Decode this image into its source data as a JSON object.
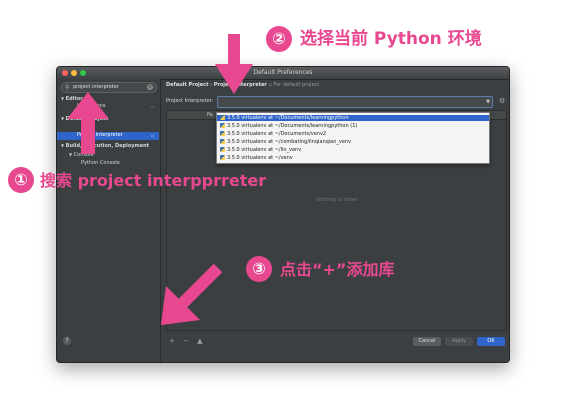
{
  "annotations": {
    "step1": {
      "number": "①",
      "text": "搜索 project interpprreter"
    },
    "step2": {
      "number": "②",
      "text": "选择当前 Python 环境"
    },
    "step3": {
      "number": "③",
      "text": "点击“+”添加库"
    },
    "accent_color": "#e8488f"
  },
  "window": {
    "title": "Default Preferences",
    "traffic_lights": [
      "#fc605b",
      "#fdbc40",
      "#34c84a"
    ]
  },
  "sidebar": {
    "search_value": "project interpreter",
    "items": [
      {
        "label": "Editor",
        "expanded": true
      },
      {
        "label": "Inspections"
      },
      {
        "label": "Default Project",
        "expanded": true
      },
      {
        "label": "Project Interpreter",
        "selected": true
      },
      {
        "label": "Build, Execution, Deployment",
        "expanded": true
      },
      {
        "label": "Console",
        "expanded": true
      },
      {
        "label": "Python Console"
      }
    ]
  },
  "main": {
    "breadcrumb_parent": "Default Project",
    "breadcrumb_sep": "›",
    "breadcrumb_current": "Project Interpreter",
    "breadcrumb_sub": "For default project",
    "interpreter_label": "Project Interpreter:",
    "column_label": "Pa",
    "empty_text": "Nothing to show",
    "table_tools": "+ − ▲"
  },
  "dropdown": {
    "items": [
      {
        "label": "3.5.0 virtualenv at ~/Documents/learningpython",
        "selected": true
      },
      {
        "label": "3.5.0 virtualenv at ~/Documents/learningpython (1)"
      },
      {
        "label": "3.5.0 virtualenv at ~/Documents/venv2"
      },
      {
        "label": "3.5.0 virtualenv at ~/combating/linqianqian_venv"
      },
      {
        "label": "3.5.0 virtualenv at ~/lin_venv"
      },
      {
        "label": "3.5.0 virtualenv at ~/venv"
      }
    ]
  },
  "footer": {
    "help": "?",
    "cancel": "Cancel",
    "apply": "Apply",
    "ok": "OK"
  }
}
